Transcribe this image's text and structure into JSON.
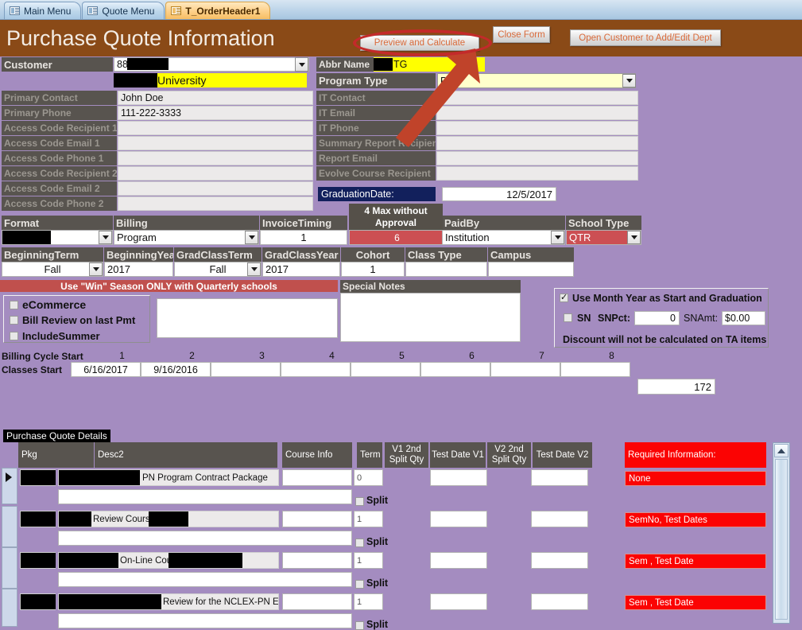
{
  "tabs": [
    {
      "label": "Main Menu",
      "icon": "form-icon",
      "active": false
    },
    {
      "label": "Quote Menu",
      "icon": "form-icon",
      "active": false
    },
    {
      "label": "T_OrderHeader1",
      "icon": "form-icon",
      "active": true
    }
  ],
  "header": {
    "title": "Purchase Quote Information",
    "buttons": {
      "preview": "Preview and Calculate",
      "close": "Close Form",
      "open_customer": "Open Customer to Add/Edit Dept"
    },
    "annotation": {
      "shape": "red-oval-highlight",
      "target": "Preview and Calculate",
      "arrow": "red-arrow"
    }
  },
  "colors": {
    "header_brown": "#8a4a17",
    "form_background": "#a48cc0",
    "label_gray": "#58544f",
    "accent_red": "#c0504d",
    "required_red": "#fb0303",
    "highlight_yellow": "#ffff00",
    "navy": "#12205c"
  },
  "left_form": {
    "customer_label": "Customer",
    "customer_value": "88",
    "customer_redacted": true,
    "customer_name_value": "University",
    "customer_name_redacted": true,
    "rows": [
      {
        "label": "Primary Contact",
        "value": "John Doe",
        "dim": true
      },
      {
        "label": "Primary Phone",
        "value": "111-222-3333",
        "dim": true
      },
      {
        "label": "Access Code Recipient 1",
        "value": "",
        "dim": true
      },
      {
        "label": "Access Code Email 1",
        "value": "",
        "dim": true
      },
      {
        "label": "Access Code Phone 1",
        "value": "",
        "dim": true
      },
      {
        "label": "Access Code Recipient 2",
        "value": "",
        "dim": true
      },
      {
        "label": "Access Code Email 2",
        "value": "",
        "dim": true
      },
      {
        "label": "Access Code Phone 2",
        "value": "",
        "dim": true
      }
    ]
  },
  "right_form": {
    "abbr_label": "Abbr Name",
    "abbr_value": "TG",
    "abbr_redacted": true,
    "program_type_label": "Program Type",
    "program_type_value": "PN",
    "rows": [
      {
        "label": "IT Contact",
        "value": ""
      },
      {
        "label": "IT Email",
        "value": ""
      },
      {
        "label": "IT Phone",
        "value": ""
      },
      {
        "label": "Summary Report Recipient",
        "value": ""
      },
      {
        "label": "Report Email",
        "value": ""
      },
      {
        "label": "Evolve Course Recipient",
        "value": ""
      }
    ],
    "graduation_date_label": "GraduationDate:",
    "graduation_date_value": "12/5/2017"
  },
  "format_row": {
    "format_label": "Format",
    "format_value": "",
    "format_redacted": true,
    "billing_label": "Billing",
    "billing_value": "Program",
    "invoice_timing_label": "InvoiceTiming",
    "invoice_timing_value": "1",
    "max_tooltip": "4 Max  without Approval",
    "max_value": "6",
    "paidby_label": "PaidBy",
    "paidby_value": "Institution",
    "school_type_label": "School Type",
    "school_type_value": "QTR"
  },
  "term_row": {
    "beginning_term_label": "BeginningTerm",
    "beginning_term_value": "Fall",
    "beginning_year_label": "BeginningYear",
    "beginning_year_value": "2017",
    "grad_class_term_label": "GradClassTerm",
    "grad_class_term_value": "Fall",
    "grad_class_year_label": "GradClassYear",
    "grad_class_year_value": "2017",
    "cohort_label": "Cohort",
    "cohort_value": "1",
    "class_type_label": "Class Type",
    "class_type_value": "",
    "campus_label": "Campus",
    "campus_value": ""
  },
  "win_banner": "Use \"Win\"  Season ONLY with Quarterly schools",
  "checkbox_panel": {
    "items": [
      {
        "label": "eCommerce",
        "checked": false
      },
      {
        "label": "Bill Review on last Pmt",
        "checked": false
      },
      {
        "label": "IncludeSummer",
        "checked": false
      }
    ]
  },
  "special_notes": {
    "label": "Special Notes",
    "value": ""
  },
  "discount_panel": {
    "use_month_year_label": "Use Month Year as Start and Graduation",
    "use_month_year_checked": true,
    "sn_label": "SN",
    "sn_checked": false,
    "snpct_label": "SNPct:",
    "snpct_value": "0",
    "snamt_label": "SNAmt:",
    "snamt_value": "$0.00",
    "note": "Discount will not be calculated on TA items"
  },
  "cycle_row": {
    "billing_cycle_label": "Billing Cycle Start",
    "classes_start_label": "Classes Start",
    "numbers": [
      "1",
      "2",
      "3",
      "4",
      "5",
      "6",
      "7",
      "8"
    ],
    "dates": [
      "6/16/2017",
      "9/16/2016",
      "",
      "",
      "",
      "",
      "",
      ""
    ],
    "total_value": "172"
  },
  "details": {
    "title": "Purchase Quote Details",
    "columns": [
      {
        "key": "pkg",
        "label": "Pkg"
      },
      {
        "key": "desc2",
        "label": "Desc2"
      },
      {
        "key": "course_info",
        "label": "Course Info"
      },
      {
        "key": "term",
        "label": "Term"
      },
      {
        "key": "v1_split",
        "label": "V1 2nd Split Qty"
      },
      {
        "key": "test_date_v1",
        "label": "Test Date V1"
      },
      {
        "key": "v2_split",
        "label": "V2 2nd Split Qty"
      },
      {
        "key": "test_date_v2",
        "label": "Test Date V2"
      },
      {
        "key": "required",
        "label": "Required Information:"
      }
    ],
    "split_label": "Split",
    "rows": [
      {
        "selected": true,
        "pkg": "",
        "pkg_redacted": true,
        "desc2": "PN Program Contract Package",
        "desc2_redacted": true,
        "course_info": "",
        "term": "0",
        "v1_split": "",
        "test_date_v1": "",
        "v2_split": "",
        "test_date_v2": "",
        "required": "None",
        "split_checked": false
      },
      {
        "selected": false,
        "pkg": "",
        "pkg_redacted": true,
        "desc2": "Review Course",
        "desc2_redacted": true,
        "course_info": "",
        "term": "1",
        "v1_split": "",
        "test_date_v1": "",
        "v2_split": "",
        "test_date_v2": "",
        "required": "SemNo, Test Dates",
        "split_checked": false
      },
      {
        "selected": false,
        "pkg": "",
        "pkg_redacted": true,
        "desc2": "On-Line Course",
        "desc2_redacted": true,
        "course_info": "",
        "term": "1",
        "v1_split": "",
        "test_date_v1": "",
        "v2_split": "",
        "test_date_v2": "",
        "required": "Sem , Test Date",
        "split_checked": false
      },
      {
        "selected": false,
        "pkg": "",
        "pkg_redacted": true,
        "desc2": "Review for the NCLEX-PN Exa",
        "desc2_redacted": true,
        "course_info": "",
        "term": "1",
        "v1_split": "",
        "test_date_v1": "",
        "v2_split": "",
        "test_date_v2": "",
        "required": "Sem , Test Date",
        "split_checked": false
      }
    ]
  }
}
